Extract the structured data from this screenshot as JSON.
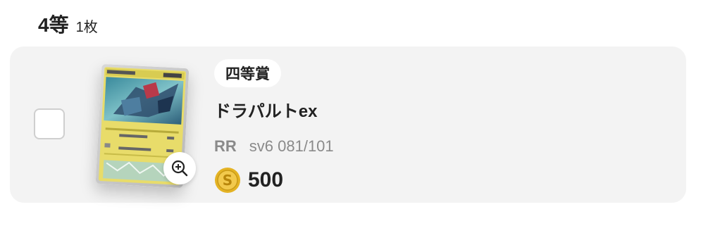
{
  "section": {
    "rank_title": "4等",
    "count": "1枚"
  },
  "card": {
    "prize_label": "四等賞",
    "name": "ドラパルトex",
    "rarity": "RR",
    "set_number": "sv6 081/101",
    "price": "500",
    "image_icon": "pokemon-card-image",
    "zoom_icon": "zoom-in-icon",
    "coin_icon": "coin-icon"
  },
  "colors": {
    "row_background": "#f3f3f3",
    "badge_background": "#ffffff",
    "meta_text": "#8a8a8a",
    "coin_gold": "#e4b324"
  }
}
